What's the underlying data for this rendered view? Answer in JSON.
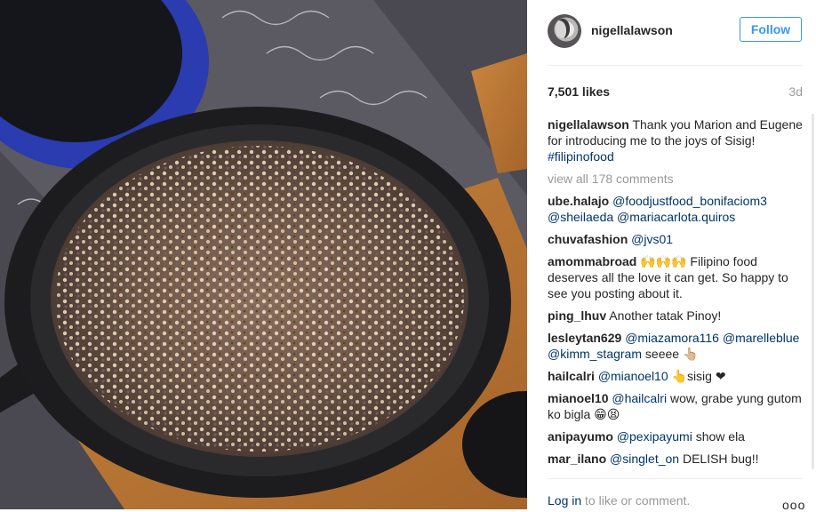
{
  "post": {
    "username": "nigellalawson",
    "follow_label": "Follow",
    "likes": "7,501 likes",
    "time": "3d",
    "caption_user": "nigellalawson",
    "caption_text": " Thank you Marion and Eugene for introducing me to the joys of Sisig! ",
    "caption_tag": "#filipinofood",
    "view_all": "view all 178 comments"
  },
  "comments": [
    {
      "user": "ube.halajo",
      "parts": [
        " ",
        "@foodjustfood_bonifaciom3",
        " ",
        "@sheilaeda",
        " ",
        "@mariacarlota.quiros"
      ]
    },
    {
      "user": "chuvafashion",
      "parts": [
        " ",
        "@jvs01"
      ]
    },
    {
      "user": "amommabroad",
      "parts": [
        " 🙌🙌🙌 Filipino food deserves all the love it can get. So happy to see you posting about it."
      ]
    },
    {
      "user": "ping_lhuv",
      "parts": [
        " Another tatak Pinoy!"
      ]
    },
    {
      "user": "lesleytan629",
      "parts": [
        " ",
        "@miazamora116",
        " ",
        "@marelleblue",
        " ",
        "@kimm_stagram",
        " seeee 👆🏼"
      ]
    },
    {
      "user": "hailcalri",
      "parts": [
        " ",
        "@mianoel10",
        " 👆sisig ❤"
      ]
    },
    {
      "user": "mianoel10",
      "parts": [
        " ",
        "@hailcalri",
        " wow, grabe yung gutom ko bigla 😁😫"
      ]
    },
    {
      "user": "anipayumo",
      "parts": [
        " ",
        "@pexipayumi",
        " show ela"
      ]
    },
    {
      "user": "mar_ilano",
      "parts": [
        " ",
        "@singlet_on",
        " DELISH bug!!"
      ]
    }
  ],
  "footer": {
    "login_link": "Log in",
    "login_rest": " to like or comment.",
    "more": "ooo"
  },
  "colors": {
    "accent": "#3897f0",
    "link": "#003569",
    "muted": "#999999"
  },
  "icons": {
    "more": "more-options-icon",
    "avatar": "profile-avatar"
  }
}
